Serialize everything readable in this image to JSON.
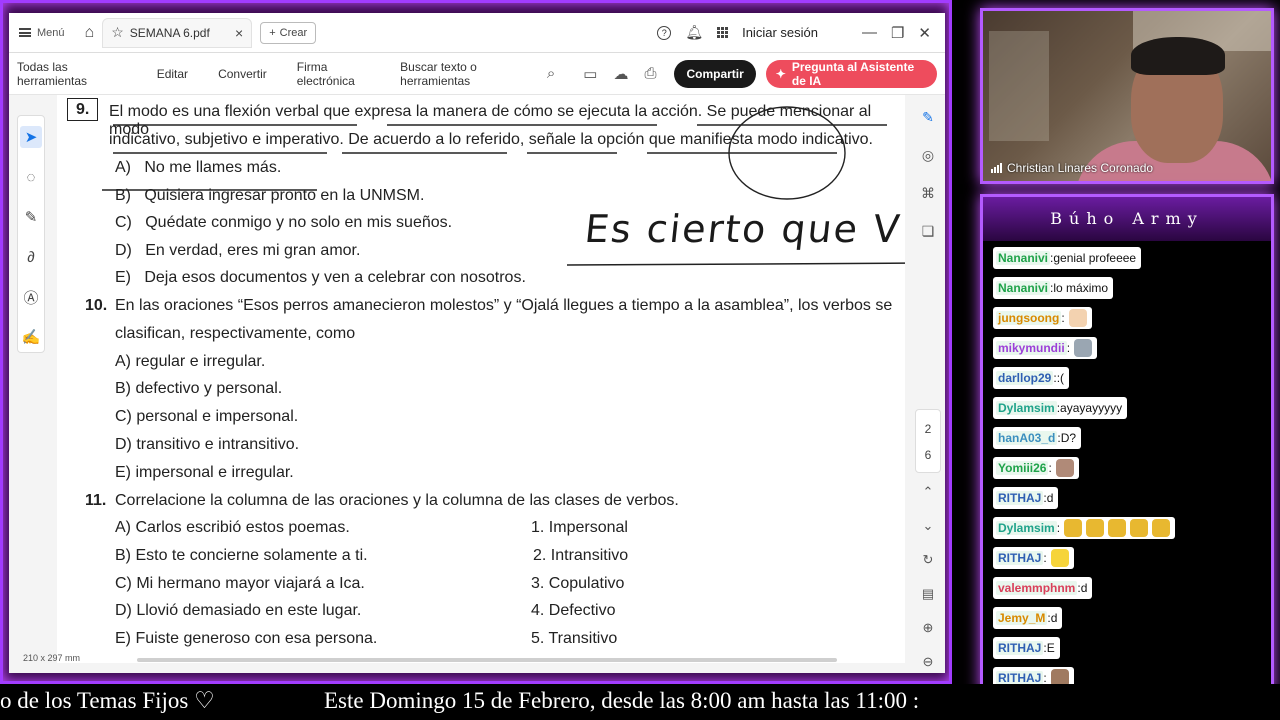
{
  "viewer": {
    "menu_label": "Menú",
    "tab_title": "SEMANA 6.pdf",
    "create_label": "Crear",
    "signin_label": "Iniciar sesión",
    "toolbar": {
      "all_tools": "Todas las herramientas",
      "edit": "Editar",
      "convert": "Convertir",
      "esign": "Firma electrónica",
      "search_placeholder": "Buscar texto o herramientas",
      "share": "Compartir",
      "ai_assistant": "Pregunta al Asistente de IA"
    },
    "page_indicator": {
      "current": "2",
      "total": "6"
    },
    "page_size": "210 x 297 mm"
  },
  "document": {
    "q9": {
      "num": "9.",
      "line1": "El modo es una flexión verbal que expresa la manera de cómo se ejecuta la acción. Se puede mencionar al modo",
      "line2": "indicativo, subjetivo e imperativo. De acuerdo a lo referido, señale la opción que manifiesta modo indicativo.",
      "options": [
        {
          "letter": "A)",
          "text": "No me llames más."
        },
        {
          "letter": "B)",
          "text": "Quisiera ingresar pronto en la UNMSM."
        },
        {
          "letter": "C)",
          "text": "Quédate conmigo y no solo en mis sueños."
        },
        {
          "letter": "D)",
          "text": "En verdad, eres mi gran amor."
        },
        {
          "letter": "E)",
          "text": "Deja esos documentos y ven a celebrar con nosotros."
        }
      ]
    },
    "handwriting": "Es cierto que V",
    "q10": {
      "num": "10.",
      "line1": "En las oraciones “Esos perros amanecieron molestos” y “Ojalá llegues a tiempo a la asamblea”, los verbos se",
      "line2": "clasifican, respectivamente, como",
      "options": [
        "A) regular e irregular.",
        "B) defectivo y personal.",
        "C) personal e impersonal.",
        "D) transitivo e intransitivo.",
        "E) impersonal e irregular."
      ]
    },
    "q11": {
      "num": "11.",
      "line1": "Correlacione la columna de las oraciones y la columna de las clases de verbos.",
      "left": [
        "A) Carlos escribió estos poemas.",
        "B) Esto te concierne solamente a ti.",
        "C) Mi hermano mayor viajará a Ica.",
        "D) Llovió demasiado en este lugar.",
        "E) Fuiste generoso con esa persona."
      ],
      "right": [
        "1. Impersonal",
        "2. Intransitivo",
        "3. Copulativo",
        "4. Defectivo",
        "5. Transitivo"
      ]
    }
  },
  "webcam": {
    "name": "Christian Linares Coronado"
  },
  "chat": {
    "title": "Búho Army",
    "messages": [
      {
        "user": "Nananivi",
        "text": "genial profeeee",
        "color": "#1fa34a",
        "emote": ""
      },
      {
        "user": "Nananivi",
        "text": "lo máximo",
        "color": "#1fa34a",
        "emote": ""
      },
      {
        "user": "jungsoong",
        "text": "",
        "color": "#d98a00",
        "emote": "hand"
      },
      {
        "user": "mikymundii",
        "text": "",
        "color": "#9c3fd8",
        "emote": "bird"
      },
      {
        "user": "darllop29",
        "text": ":(",
        "color": "#2f5fb3",
        "emote": ""
      },
      {
        "user": "Dylamsim",
        "text": "ayayayyyyy",
        "color": "#1fa38a",
        "emote": ""
      },
      {
        "user": "hanA03_d",
        "text": "D?",
        "color": "#3b8fbf",
        "emote": ""
      },
      {
        "user": "Yomiii26",
        "text": "",
        "color": "#1fa34a",
        "emote": "face"
      },
      {
        "user": "RITHAJ",
        "text": "d",
        "color": "#2f5fb3",
        "emote": ""
      },
      {
        "user": "Dylamsim",
        "text": "",
        "color": "#1fa38a",
        "emote": "cats"
      },
      {
        "user": "RITHAJ",
        "text": "",
        "color": "#2f5fb3",
        "emote": "smile"
      },
      {
        "user": "valemmphnm",
        "text": "d",
        "color": "#d9405a",
        "emote": ""
      },
      {
        "user": "Jemy_M",
        "text": "d",
        "color": "#d98a00",
        "emote": ""
      },
      {
        "user": "RITHAJ",
        "text": "E",
        "color": "#2f5fb3",
        "emote": ""
      },
      {
        "user": "RITHAJ",
        "text": "",
        "color": "#2f5fb3",
        "emote": "cat"
      }
    ]
  },
  "ticker": {
    "left": "o de los Temas Fijos ♡",
    "right": "Este Domingo 15 de Febrero, desde las 8:00 am hasta las 11:00 :"
  }
}
